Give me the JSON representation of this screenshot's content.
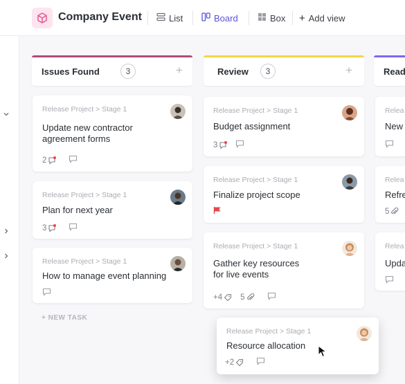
{
  "header": {
    "title": "Company Event",
    "views": [
      {
        "label": "List"
      },
      {
        "label": "Board"
      },
      {
        "label": "Box"
      },
      {
        "label": "Add view"
      }
    ]
  },
  "colors": {
    "issues_bar": "#b04a7a",
    "review_bar": "#f5d547",
    "ready_bar": "#7b68ee",
    "accent": "#5b53d6",
    "flag": "#e5484d"
  },
  "columns": [
    {
      "title": "Issues Found",
      "count": "3",
      "cards": [
        {
          "crumb": "Release Project > Stage 1",
          "title1": "Update new contractor",
          "title2": "agreement forms",
          "comments": "2"
        },
        {
          "crumb": "Release Project > Stage 1",
          "title1": "Plan for next year",
          "comments": "3"
        },
        {
          "crumb": "Release Project > Stage 1",
          "title1": "How to manage event planning"
        }
      ],
      "new_task": "+ NEW TASK"
    },
    {
      "title": "Review",
      "count": "3",
      "cards": [
        {
          "crumb": "Release Project > Stage 1",
          "title1": "Budget assignment",
          "comments": "3"
        },
        {
          "crumb": "Release Project > Stage 1",
          "title1": "Finalize project scope"
        },
        {
          "crumb": "Release Project > Stage 1",
          "title1": "Gather key resources",
          "title2": "for live events",
          "tags": "+4",
          "attachments": "5"
        }
      ]
    },
    {
      "title": "Read",
      "cards": [
        {
          "crumb": "Relea",
          "title1": "New"
        },
        {
          "crumb": "Relea",
          "title1": "Refre",
          "attachments": "5"
        },
        {
          "crumb": "Relea",
          "title1": "Upda"
        }
      ]
    }
  ],
  "dragging_card": {
    "crumb": "Release Project > Stage 1",
    "title1": "Resource allocation",
    "tags": "+2"
  }
}
